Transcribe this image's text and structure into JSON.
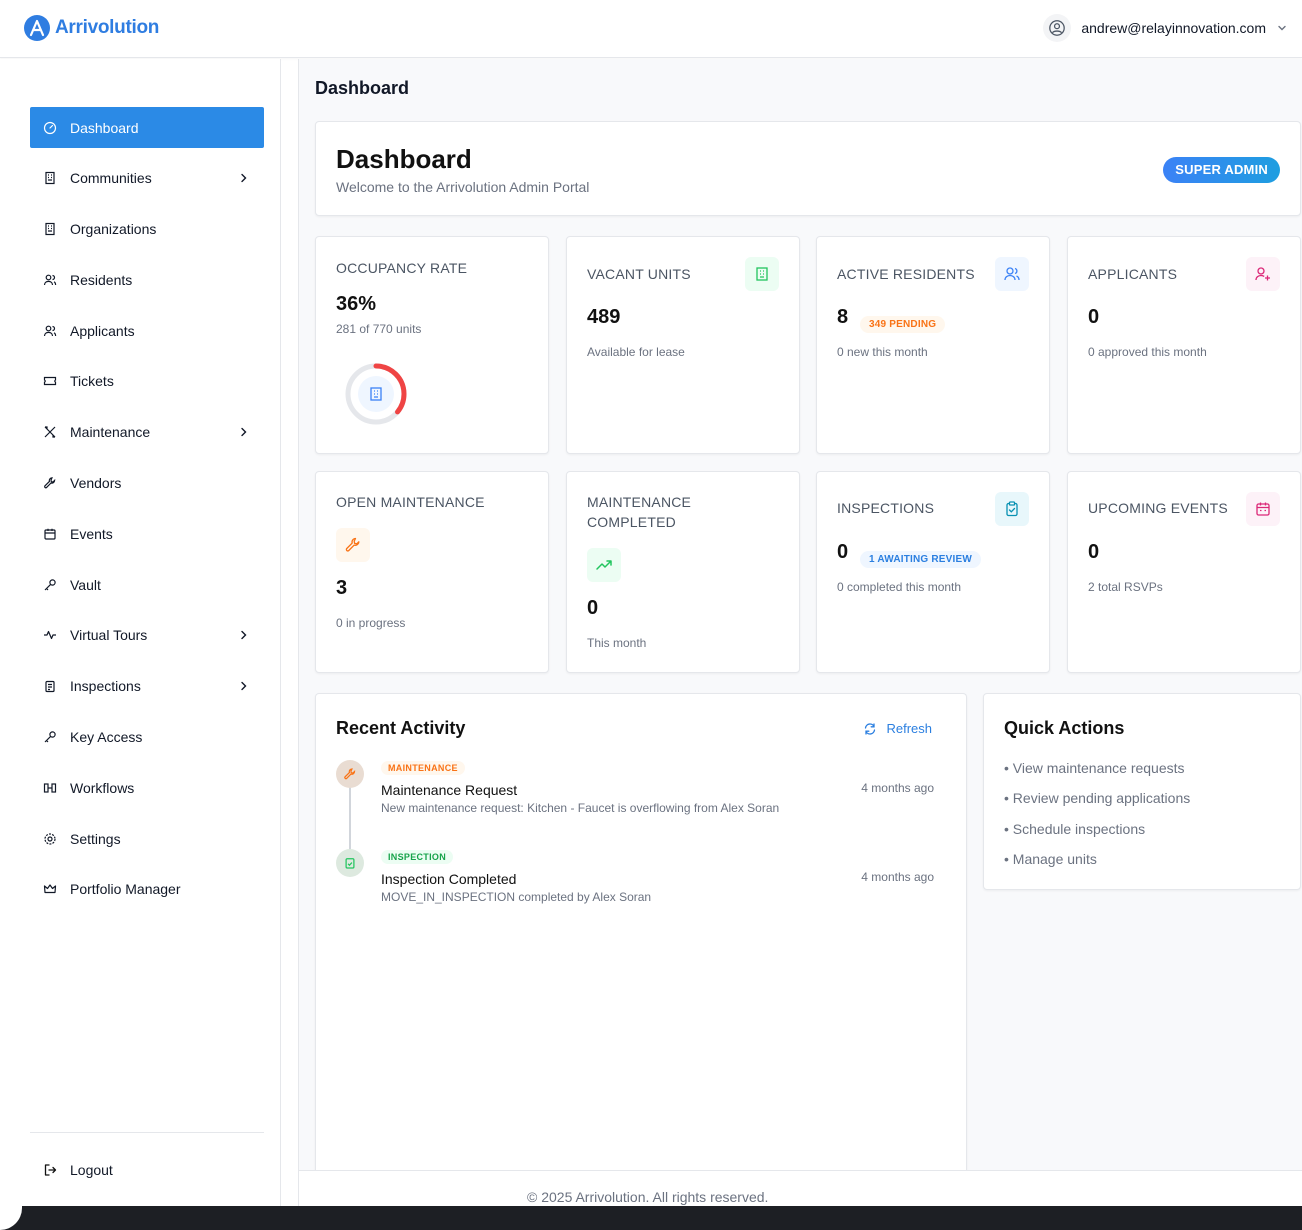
{
  "app": {
    "name": "Arrivolution"
  },
  "user": {
    "email": "andrew@relayinnovation.com"
  },
  "sidebar": {
    "items": [
      {
        "label": "Dashboard",
        "icon": "dashboard-icon",
        "active": true,
        "chevron": false
      },
      {
        "label": "Communities",
        "icon": "building-icon",
        "chevron": true
      },
      {
        "label": "Organizations",
        "icon": "building-icon",
        "chevron": false
      },
      {
        "label": "Residents",
        "icon": "users-icon",
        "chevron": false
      },
      {
        "label": "Applicants",
        "icon": "users-icon",
        "chevron": false
      },
      {
        "label": "Tickets",
        "icon": "ticket-icon",
        "chevron": false
      },
      {
        "label": "Maintenance",
        "icon": "tools-icon",
        "chevron": true
      },
      {
        "label": "Vendors",
        "icon": "wrench-icon",
        "chevron": false
      },
      {
        "label": "Events",
        "icon": "calendar-icon",
        "chevron": false
      },
      {
        "label": "Vault",
        "icon": "key-icon",
        "chevron": false
      },
      {
        "label": "Virtual Tours",
        "icon": "activity-icon",
        "chevron": true
      },
      {
        "label": "Inspections",
        "icon": "clipboard-icon",
        "chevron": true
      },
      {
        "label": "Key Access",
        "icon": "key-icon",
        "chevron": false
      },
      {
        "label": "Workflows",
        "icon": "workflow-icon",
        "chevron": false
      },
      {
        "label": "Settings",
        "icon": "gear-icon",
        "chevron": false
      },
      {
        "label": "Portfolio Manager",
        "icon": "crown-icon",
        "chevron": false
      }
    ],
    "logout": "Logout"
  },
  "page": {
    "heading": "Dashboard"
  },
  "hero": {
    "title": "Dashboard",
    "subtitle": "Welcome to the Arrivolution Admin Portal",
    "badge": "SUPER ADMIN"
  },
  "stats": {
    "occupancy": {
      "label": "OCCUPANCY RATE",
      "value": "36%",
      "sub": "281 of 770 units",
      "fraction": 0.36
    },
    "vacant": {
      "label": "VACANT UNITS",
      "value": "489",
      "sub": "Available for lease"
    },
    "residents": {
      "label": "ACTIVE RESIDENTS",
      "value": "8",
      "pill": "349 PENDING",
      "sub": "0 new this month"
    },
    "applicants": {
      "label": "APPLICANTS",
      "value": "0",
      "sub": "0 approved this month"
    },
    "open_maintenance": {
      "label": "OPEN MAINTENANCE",
      "value": "3",
      "sub": "0 in progress"
    },
    "maint_completed": {
      "label_line1": "MAINTENANCE",
      "label_line2": "COMPLETED",
      "value": "0",
      "sub": "This month"
    },
    "inspections": {
      "label": "INSPECTIONS",
      "value": "0",
      "pill": "1 AWAITING REVIEW",
      "sub": "0 completed this month"
    },
    "events": {
      "label": "UPCOMING EVENTS",
      "value": "0",
      "sub": "2 total RSVPs"
    }
  },
  "activity": {
    "title": "Recent Activity",
    "refresh": "Refresh",
    "items": [
      {
        "tag": "MAINTENANCE",
        "title": "Maintenance Request",
        "desc": "New maintenance request: Kitchen - Faucet is overflowing from Alex Soran",
        "time": "4 months ago"
      },
      {
        "tag": "INSPECTION",
        "title": "Inspection Completed",
        "desc": "MOVE_IN_INSPECTION completed by Alex Soran",
        "time": "4 months ago"
      }
    ]
  },
  "quick_actions": {
    "title": "Quick Actions",
    "items": [
      "• View maintenance requests",
      "• Review pending applications",
      "• Schedule inspections",
      "• Manage units"
    ]
  },
  "footer": {
    "text": "© 2025 Arrivolution. All rights reserved."
  },
  "colors": {
    "primary": "#2b8ae6",
    "ring": "#ef4444",
    "orange": "#f97316",
    "green": "#22c55e",
    "pink": "#db2777"
  }
}
